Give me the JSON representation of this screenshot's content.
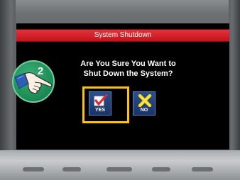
{
  "dialog": {
    "title": "System Shutdown",
    "question_line1": "Are You Sure You Want to",
    "question_line2": "Shut Down the System?"
  },
  "buttons": {
    "yes_label": "YES",
    "no_label": "NO"
  },
  "step_marker": {
    "number": "2"
  },
  "colors": {
    "title_bar": "#c5121b",
    "button_bg": "#1b3467",
    "highlight": "#ffc400",
    "yes_check": "#e3282f",
    "no_cross": "#ffd400",
    "marker_green": "#1f8e57"
  }
}
